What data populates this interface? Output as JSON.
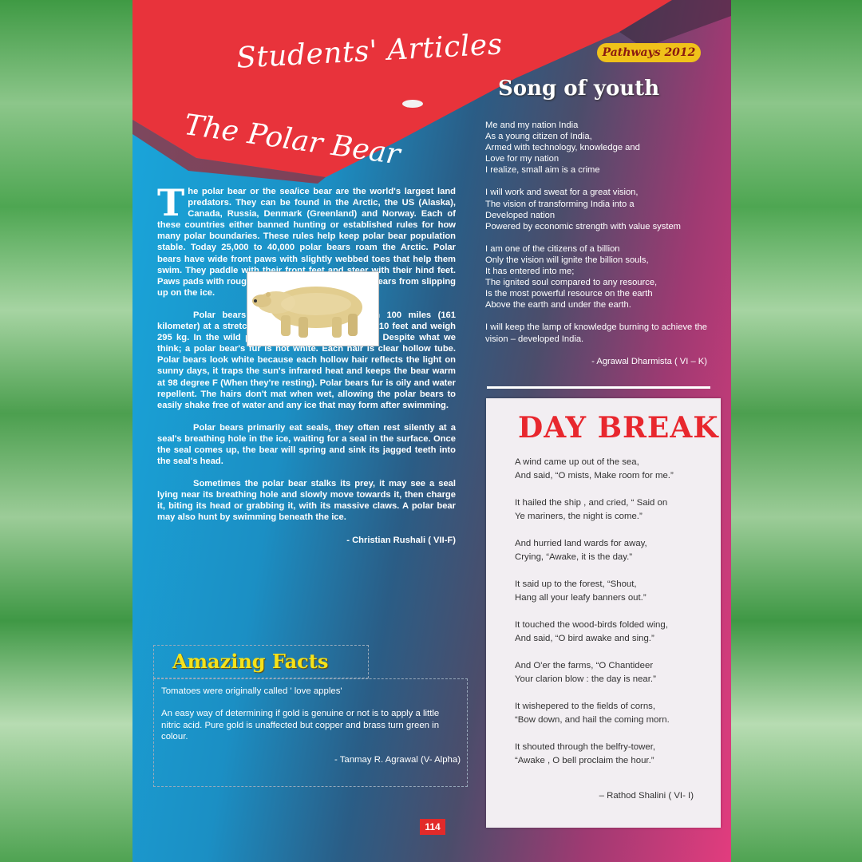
{
  "header": {
    "section_title": "Students' Articles",
    "article_title": "The Polar Bear",
    "badge": "Pathways 2012"
  },
  "polar_bear": {
    "dropcap": "T",
    "p1_lead": "he polar bear or the sea/ice bear are the world's largest land predators. They can be found in the Arctic, the US (Alaska), Canada, Russia, Denmark (Greenland) and Norway. Each of these countries either banned hunting or established rules for how many polar boundaries. These rules help keep polar bear population stable. Today 25,000 to 40,000 polar bears roam the Arctic. Polar bears have wide front paws with slightly webbed toes that help them swim. They paddle with their front feet and steer with their hind feet. Paws pads with rough surface help prevent, Polar bears from slipping up on the ice.",
    "p2": "Polar bears have been known to swim 100 miles (161 kilometer) at a stretch. Male polar bears may grow 10 feet and weigh 295 kg. In the wild polar bears live up to age 25. Despite what we think; a polar bear's fur is not white. Each hair is clear hollow tube. Polar bears look white because each hollow hair reflects the light on sunny days, it traps the sun's infrared heat and keeps the bear warm at 98 degree F (When they're resting). Polar bears fur is oily and water repellent. The hairs don't mat when wet, allowing the polar bears to easily shake free of water and any ice that may form after swimming.",
    "p3": "Polar bears primarily eat seals, they often rest silently at a seal's breathing hole in the ice, waiting for a seal in the surface. Once the seal comes up, the bear will spring and sink its jagged teeth into the seal's head.",
    "p4": "Sometimes the polar bear stalks its prey, it may see a seal lying near its breathing hole and slowly move towards it, then charge it, biting its head or grabbing it, with its massive claws. A polar bear may also hunt by swimming beneath the ice.",
    "author": "- Christian Rushali ( VII-F)"
  },
  "facts": {
    "heading": "Amazing Facts",
    "f1": "Tomatoes were originally called ' love apples'",
    "f2": "An easy way of determining if gold is genuine or not is to apply a little nitric acid. Pure gold is unaffected but copper and brass turn green in colour.",
    "author": "- Tanmay R. Agrawal (V- Alpha)"
  },
  "song": {
    "title": "Song of youth",
    "s1": [
      "Me and my nation India",
      "As a young citizen of India,",
      "Armed with technology, knowledge and",
      "Love for my nation",
      "I realize, small aim is a crime"
    ],
    "s2": [
      "I will work and sweat for a great vision,",
      "The vision of transforming India into a",
      "Developed nation",
      "Powered by economic strength with value system"
    ],
    "s3": [
      "I am one of the citizens of a billion",
      "Only the vision will ignite the billion souls,",
      "It has entered into me;",
      "The ignited soul compared to any resource,",
      "Is the most powerful resource on the earth",
      "Above the earth and under the earth."
    ],
    "s4": "I will keep the lamp of knowledge burning to achieve the vision – developed India.",
    "author": "- Agrawal Dharmista ( VI – K)"
  },
  "daybreak": {
    "title": "DAY BREAK",
    "stanzas": [
      [
        "A wind came up out of the sea,",
        "And said, “O mists, Make room for me.”"
      ],
      [
        "It hailed the ship , and cried, “ Said on",
        "Ye mariners, the night is come.”"
      ],
      [
        "And hurried land wards for away,",
        "Crying, “Awake, it is the day.”"
      ],
      [
        "It said up to the forest, “Shout,",
        "Hang all your leafy banners out.”"
      ],
      [
        "It touched the wood-birds folded wing,",
        "And said, “O bird awake and sing.”"
      ],
      [
        "And O'er the farms, “O Chantideer",
        "Your clarion blow : the day is near.”"
      ],
      [
        "It wishepered to the fields of corns,",
        "“Bow down, and hail the coming morn."
      ],
      [
        "It shouted through the belfry-tower,",
        "“Awake , O bell  proclaim the hour.”"
      ]
    ],
    "author": "– Rathod Shalini ( VI-  I)"
  },
  "page_number": "114"
}
